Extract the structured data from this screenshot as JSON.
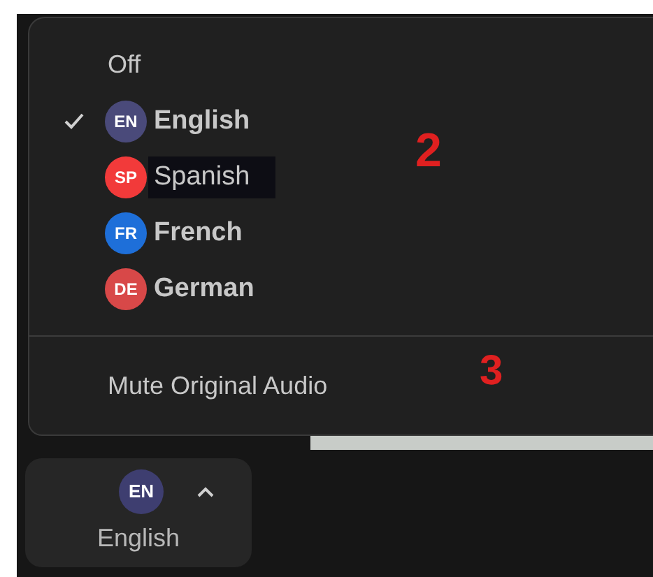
{
  "menu": {
    "off_item": {
      "label": "Off"
    },
    "languages": [
      {
        "badge": "EN",
        "label": "English",
        "color": "#4a4a7a",
        "checked": true,
        "hovered": false
      },
      {
        "badge": "SP",
        "label": "Spanish",
        "color": "#f23a3a",
        "checked": false,
        "hovered": true
      },
      {
        "badge": "FR",
        "label": "French",
        "color": "#1e6fd9",
        "checked": false,
        "hovered": false
      },
      {
        "badge": "DE",
        "label": "German",
        "color": "#d84848",
        "checked": false,
        "hovered": false
      }
    ],
    "mute_item": {
      "label": "Mute Original Audio"
    }
  },
  "annotations": [
    "2",
    "3"
  ],
  "language_button": {
    "badge": "EN",
    "label": "English"
  }
}
